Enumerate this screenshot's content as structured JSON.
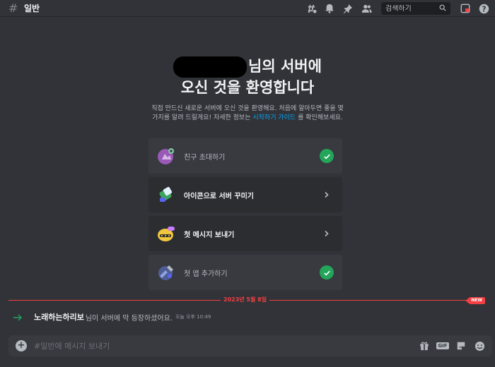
{
  "topbar": {
    "channel_name": "일반",
    "search_placeholder": "검색하기"
  },
  "welcome": {
    "title_suffix": "님의 서버에",
    "title_line2": "오신 것을 환영합니다",
    "desc_part1": "직접 만드신 새로운 서버에 오신 것을 환영해요. 처음에 알아두면 좋을 몇 가지를 알려 드릴게요! 자세한 정보는",
    "desc_link": "시작하기 가이드",
    "desc_part2": "를 확인해보세요."
  },
  "checklist": [
    {
      "label": "친구 초대하기",
      "status": "done"
    },
    {
      "label": "아이콘으로 서버 꾸미기",
      "status": "todo"
    },
    {
      "label": "첫 메시지 보내기",
      "status": "todo"
    },
    {
      "label": "첫 앱 추가하기",
      "status": "done"
    }
  ],
  "divider": {
    "date": "2023년 5월 8일",
    "badge": "NEW"
  },
  "join_message": {
    "user": "노래하는하리보",
    "text": "님이 서버에 막 등장하셨어요.",
    "time": "오늘 오후 10:49"
  },
  "composer": {
    "placeholder": "#일반에 메시지 보내기",
    "gif_label": "GIF"
  },
  "colors": {
    "background": "#313338",
    "accent_red": "#f23f42",
    "success_green": "#23a55a",
    "link_blue": "#00a8fc"
  },
  "icons": [
    "hash-icon",
    "threads-icon",
    "bell-icon",
    "pin-icon",
    "members-icon",
    "search-icon",
    "inbox-icon",
    "help-icon",
    "plus-icon",
    "gift-icon",
    "gif-icon",
    "sticker-icon",
    "emoji-icon",
    "arrow-right-icon",
    "check-icon",
    "chevron-right-icon"
  ]
}
